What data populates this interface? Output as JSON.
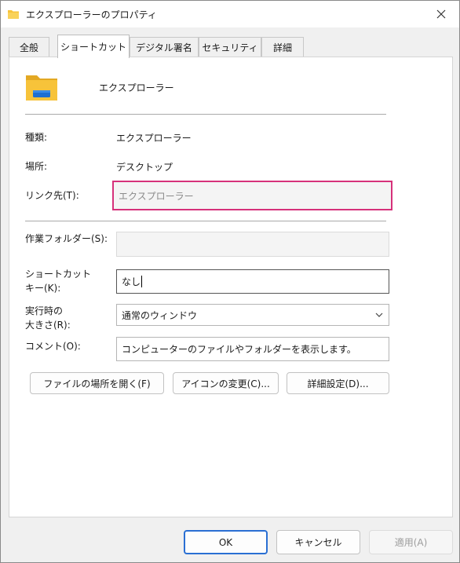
{
  "window": {
    "title": "エクスプローラーのプロパティ"
  },
  "tabs": [
    {
      "label": "全般"
    },
    {
      "label": "ショートカット"
    },
    {
      "label": "デジタル署名"
    },
    {
      "label": "セキュリティ"
    },
    {
      "label": "詳細"
    }
  ],
  "active_tab": "ショートカット",
  "shortcut": {
    "name": "エクスプローラー",
    "type_label": "種類:",
    "type_value": "エクスプローラー",
    "location_label": "場所:",
    "location_value": "デスクトップ",
    "target_label": "リンク先(T):",
    "target_value": "エクスプローラー",
    "workdir_label": "作業フォルダー(S):",
    "workdir_value": "",
    "hotkey_label_line1": "ショートカット",
    "hotkey_label_line2": "キー(K):",
    "hotkey_value": "なし",
    "run_label_line1": "実行時の",
    "run_label_line2": "大きさ(R):",
    "run_value": "通常のウィンドウ",
    "comment_label": "コメント(O):",
    "comment_value": "コンピューターのファイルやフォルダーを表示します。"
  },
  "actions": {
    "open_location": "ファイルの場所を開く(F)",
    "change_icon": "アイコンの変更(C)...",
    "advanced": "詳細設定(D)..."
  },
  "footer": {
    "ok": "OK",
    "cancel": "キャンセル",
    "apply": "適用(A)"
  },
  "colors": {
    "highlight_border": "#d6317a",
    "primary_button_border": "#2a6fd3",
    "folder_yellow": "#f7c33a",
    "folder_blue": "#1f6fd1"
  },
  "icons": {
    "title": "folder-icon",
    "app": "file-explorer-icon",
    "close": "close-icon",
    "dropdown": "chevron-down-icon"
  }
}
